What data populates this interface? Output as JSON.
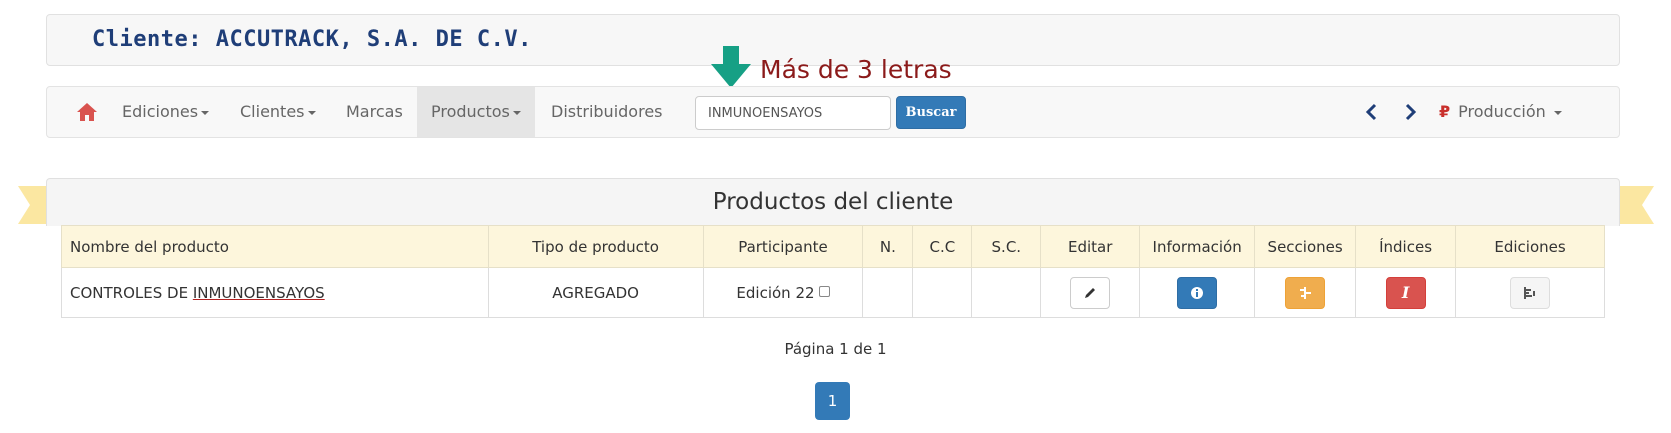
{
  "client": {
    "title": "Cliente: ACCUTRACK, S.A. DE C.V."
  },
  "nav": {
    "home_icon": "home-icon",
    "ediciones": "Ediciones",
    "clientes": "Clientes",
    "marcas": "Marcas",
    "productos": "Productos",
    "distribuidores": "Distribuidores",
    "search_value": "INMUNOENSAYOS",
    "search_button": "Buscar",
    "prev_icon": "chevron-left-icon",
    "next_icon": "chevron-right-icon",
    "produccion": "Producción",
    "produccion_icon": "₽"
  },
  "hint": {
    "text": "Más de 3 letras",
    "arrow_color": "#16a085"
  },
  "panel": {
    "title": "Productos del cliente"
  },
  "table": {
    "headers": [
      "Nombre del producto",
      "Tipo de producto",
      "Participante",
      "N.",
      "C.C",
      "S.C.",
      "Editar",
      "Información",
      "Secciones",
      "Índices",
      "Ediciones"
    ],
    "rows": [
      {
        "name_prefix": "CONTROLES DE",
        "name_match": "INMUNOENSAYOS",
        "tipo": "AGREGADO",
        "participante": "Edición 22",
        "n": "",
        "cc": "",
        "sc": "",
        "indices_glyph": "I"
      }
    ]
  },
  "pagination": {
    "label": "Página 1 de 1",
    "current": "1"
  },
  "colors": {
    "primary": "#337ab7",
    "warning": "#f0ad4e",
    "danger": "#d9534f",
    "home": "#d9534f",
    "header_bg": "#fdf6dc",
    "ribbon": "#fbe7a1"
  }
}
